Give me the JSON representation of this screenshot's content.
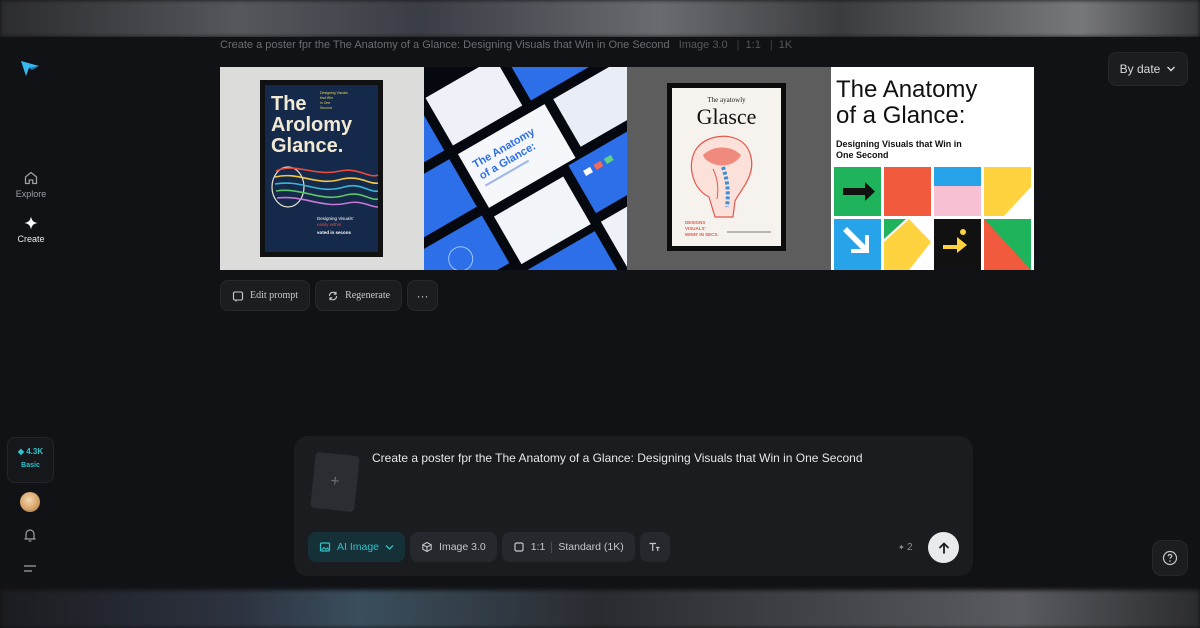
{
  "prompt": {
    "text": "Create a poster fpr the The Anatomy of a Glance: Designing Visuals that Win in One Second",
    "model": "Image 3.0",
    "ratio": "1:1",
    "resolution": "1K"
  },
  "sidebar": {
    "items": [
      {
        "label": "Explore",
        "icon": "home-icon"
      },
      {
        "label": "Create",
        "icon": "sparkle-icon"
      }
    ],
    "credits": {
      "amount": "4.3K",
      "tier": "Basic"
    }
  },
  "sort": {
    "label": "By date"
  },
  "gallery": {
    "tile1": {
      "title": [
        "The",
        "Arolomy",
        "Glance."
      ],
      "subtitle": "Designing Visuals",
      "caption": [
        "that Win",
        "in One",
        "Second"
      ],
      "footer": [
        "Designing Visuals'",
        "easily within",
        "voted in secons"
      ]
    },
    "tile2": {
      "title": [
        "The Anatomy",
        "of a Glance:"
      ]
    },
    "tile3": {
      "title": [
        "The ayatowly",
        "Glasce"
      ],
      "caption": [
        "DESIGNS",
        "VISUALS'",
        "WINN' IN SECS."
      ]
    },
    "tile4": {
      "title": [
        "The Anatomy",
        "of a Glance:"
      ],
      "subtitle": [
        "Designing Visuals that Win in",
        "One Second"
      ]
    }
  },
  "actions": {
    "edit": "Edit prompt",
    "regenerate": "Regenerate",
    "more": "···"
  },
  "composer": {
    "text": "Create a poster fpr the The Anatomy of a Glance: Designing Visuals that Win in One Second",
    "upload": "+",
    "mode": "AI Image",
    "model": "Image 3.0",
    "ratio": "1:1",
    "quality": "Standard (1K)",
    "cost": "2"
  },
  "colors": {
    "accent": "#2ec2c9",
    "background": "#111215",
    "panel": "#1b1c20"
  }
}
